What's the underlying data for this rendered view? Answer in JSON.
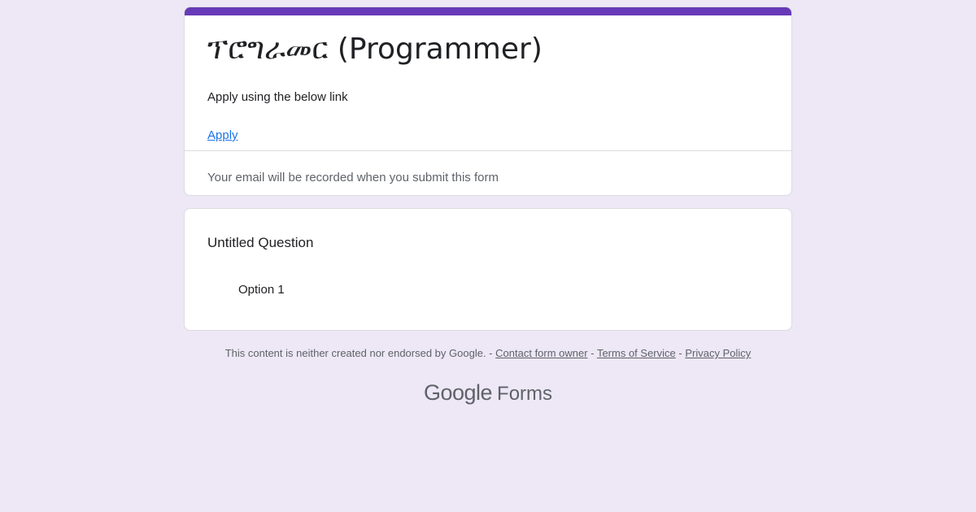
{
  "form": {
    "title": "ፕሮግራመር (Programmer)",
    "description": "Apply using the below link",
    "link_label": "Apply",
    "email_notice": "Your email will be recorded when you submit this form"
  },
  "question": {
    "title": "Untitled Question",
    "options": [
      {
        "label": "Option 1"
      }
    ]
  },
  "footer": {
    "disclaimer": "This content is neither created nor endorsed by Google.",
    "separator": "-",
    "links": {
      "contact": "Contact form owner",
      "terms": "Terms of Service",
      "privacy": "Privacy Policy"
    }
  },
  "brand": {
    "google": "Google",
    "forms": "Forms"
  },
  "colors": {
    "page_background": "#ede7f6",
    "accent": "#673ab7",
    "link": "#1a73e8",
    "text_primary": "#202124",
    "text_secondary": "#5f6368"
  }
}
